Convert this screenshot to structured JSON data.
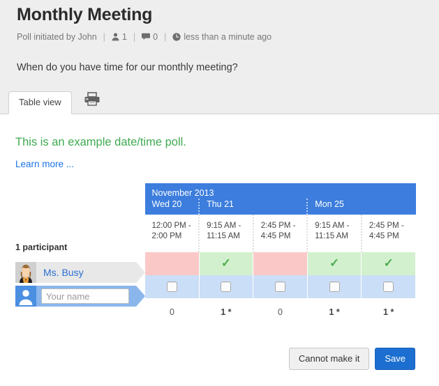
{
  "header": {
    "title": "Monthly Meeting",
    "meta": {
      "initiated_by": "Poll initiated by John",
      "participants_icon": "person-icon",
      "participants_count": "1",
      "comments_icon": "comment-icon",
      "comments_count": "0",
      "time_icon": "clock-icon",
      "time_ago": "less than a minute ago",
      "separator": "|"
    },
    "question": "When do you have time for our monthly meeting?"
  },
  "tabs": [
    {
      "label": "Table view",
      "name": "tab-table-view",
      "active": true
    },
    {
      "label": "",
      "name": "tab-print",
      "icon": "printer-icon",
      "active": false
    }
  ],
  "notices": {
    "example_note": "This is an example date/time poll.",
    "learn_more": "Learn more ..."
  },
  "table": {
    "participant_summary": "1 participant",
    "month_label": "November 2013",
    "days": [
      {
        "label": "Wed 20",
        "span": 1
      },
      {
        "label": "Thu 21",
        "span": 2
      },
      {
        "label": "Mon 25",
        "span": 2
      }
    ],
    "slots": [
      {
        "start": "12:00 PM -",
        "end": "2:00 PM"
      },
      {
        "start": "9:15 AM -",
        "end": "11:15 AM"
      },
      {
        "start": "2:45 PM -",
        "end": "4:45 PM"
      },
      {
        "start": "9:15 AM -",
        "end": "11:15 AM"
      },
      {
        "start": "2:45 PM -",
        "end": "4:45 PM"
      }
    ],
    "rows": [
      {
        "name": "Ms. Busy",
        "avatar": "woman-avatar-icon",
        "votes": [
          "no",
          "yes",
          "no",
          "yes",
          "yes"
        ],
        "check_glyph": "✓"
      }
    ],
    "my_row": {
      "avatar": "person-avatar-icon",
      "input_placeholder": "Your name",
      "input_value": "",
      "votes": [
        "",
        "",
        "",
        "",
        ""
      ]
    },
    "counts": [
      "0",
      "1 *",
      "0",
      "1 *",
      "1 *"
    ]
  },
  "actions": {
    "cannot_make_it": "Cannot make it",
    "save": "Save"
  },
  "colors": {
    "header_blue": "#3c7ddd",
    "yes_green": "#d2f0ce",
    "no_red": "#fbc8c8",
    "my_blue": "#cbdef7",
    "note_green": "#3faa51",
    "link_blue": "#1a73e8",
    "save_blue": "#1c6fd0",
    "page_gray": "#eeeeee"
  }
}
